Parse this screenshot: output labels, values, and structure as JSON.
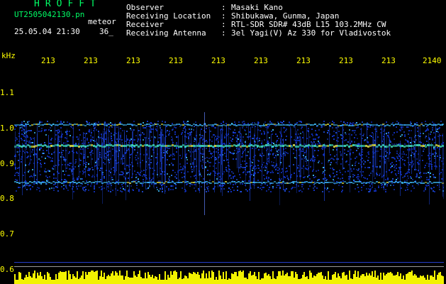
{
  "header": {
    "title": "HROFFT",
    "filename": "UT2505042130.pn",
    "meteor_label": "meteor",
    "datetime": "25.05.04 21:30",
    "count": "36_"
  },
  "info": [
    {
      "label": "Observer",
      "sep": ":",
      "value": "Masaki Kano"
    },
    {
      "label": "Receiving Location",
      "sep": ":",
      "value": "Shibukawa, Gunma, Japan"
    },
    {
      "label": "Receiver",
      "sep": ":",
      "value": "RTL-SDR SDR# 43dB L15 103.2MHz CW"
    },
    {
      "label": "Receiving Antenna",
      "sep": ":",
      "value": "3el Yagi(V) Az 330 for Vladivostok"
    }
  ],
  "axis": {
    "y_unit": "kHz",
    "y_ticks": [
      "1.1",
      "1.0",
      "0.9",
      "0.8",
      "0.7",
      "0.6"
    ],
    "x_ticks": [
      "213",
      "213",
      "213",
      "213",
      "213",
      "213",
      "213",
      "213",
      "213",
      "2140"
    ]
  },
  "colors": {
    "header_green": "#00ff66",
    "axis_yellow": "#ffff00",
    "background": "#000000",
    "spectrum_blue": "#1030c0",
    "band_cyan": "#40c0ff"
  }
}
